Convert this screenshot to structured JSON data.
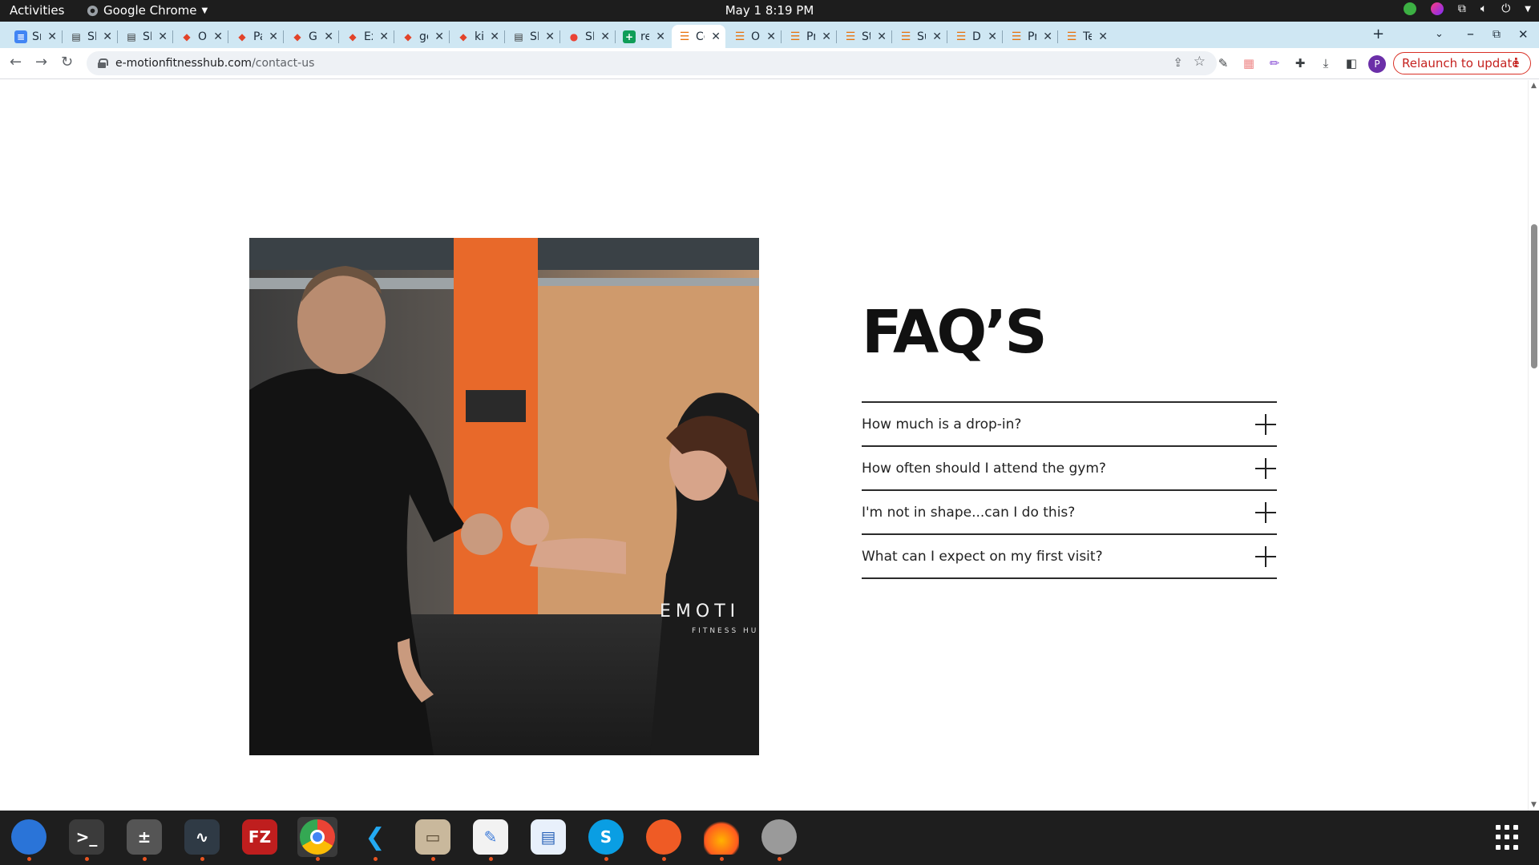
{
  "topbar": {
    "activities": "Activities",
    "app_name": "Google Chrome",
    "clock": "May 1  8:19 PM"
  },
  "tabs": [
    {
      "title": "Sni",
      "icon": "docs-icon",
      "color": "#4285f4"
    },
    {
      "title": "SNI",
      "icon": "snp-icon",
      "color": "#333333"
    },
    {
      "title": "SNI",
      "icon": "snp-icon",
      "color": "#333333"
    },
    {
      "title": "On",
      "icon": "gitlab-icon",
      "color": "#e24329"
    },
    {
      "title": "Pai",
      "icon": "gitlab-icon",
      "color": "#e24329"
    },
    {
      "title": "Gel",
      "icon": "gitlab-icon",
      "color": "#e24329"
    },
    {
      "title": "Exp",
      "icon": "gitlab-icon",
      "color": "#e24329"
    },
    {
      "title": "gel",
      "icon": "gitlab-icon",
      "color": "#e24329"
    },
    {
      "title": "kit",
      "icon": "gitlab-icon",
      "color": "#e24329"
    },
    {
      "title": "SNI",
      "icon": "snp-icon",
      "color": "#333333"
    },
    {
      "title": "SN",
      "icon": "chrome-icon",
      "color": "#34a853"
    },
    {
      "title": "ref",
      "icon": "sheets-icon",
      "color": "#0f9d58"
    },
    {
      "title": "Co",
      "icon": "menu-icon",
      "color": "#e8710a"
    },
    {
      "title": "On",
      "icon": "menu-icon",
      "color": "#e8710a"
    },
    {
      "title": "Pri",
      "icon": "menu-icon",
      "color": "#e8710a"
    },
    {
      "title": "Sta",
      "icon": "menu-icon",
      "color": "#e8710a"
    },
    {
      "title": "Su",
      "icon": "menu-icon",
      "color": "#e8710a"
    },
    {
      "title": "Do",
      "icon": "menu-icon",
      "color": "#e8710a"
    },
    {
      "title": "Pri",
      "icon": "menu-icon",
      "color": "#e8710a"
    },
    {
      "title": "Ter",
      "icon": "menu-icon",
      "color": "#e8710a"
    }
  ],
  "active_tab_index": 12,
  "address_bar": {
    "domain": "e-motionfitnesshub.com",
    "path": "/contact-us"
  },
  "relaunch_label": "Relaunch to update",
  "profile_initial": "P",
  "faq": {
    "title": "FAQ’S",
    "items": [
      {
        "question": "How much is a drop-in?"
      },
      {
        "question": "How often should I attend the gym?"
      },
      {
        "question": "I'm not in shape...can I do this?"
      },
      {
        "question": "What can I expect on my first visit?"
      }
    ]
  },
  "photo": {
    "shirt_text": "EMOTI",
    "shirt_subtext": "FITNESS HU"
  },
  "dock": [
    {
      "name": "thunderbird-icon",
      "label": "",
      "color": "#2a74d8"
    },
    {
      "name": "terminal-icon",
      "label": ">_",
      "color": "#3b3b3b"
    },
    {
      "name": "calculator-icon",
      "label": "±",
      "color": "#555555"
    },
    {
      "name": "system-monitor-icon",
      "label": "∿",
      "color": "#2f3a45"
    },
    {
      "name": "filezilla-icon",
      "label": "FZ",
      "color": "#bf1e1e"
    },
    {
      "name": "chrome-icon",
      "label": "",
      "color": "#ffffff"
    },
    {
      "name": "vscode-icon",
      "label": "",
      "color": "#1e1e1e"
    },
    {
      "name": "files-icon",
      "label": "",
      "color": "#c9b89c"
    },
    {
      "name": "text-editor-icon",
      "label": "",
      "color": "#f2f2f2"
    },
    {
      "name": "libreoffice-writer-icon",
      "label": "",
      "color": "#e8f0fb"
    },
    {
      "name": "skype-icon",
      "label": "S",
      "color": "#0a9ee3"
    },
    {
      "name": "postman-icon",
      "label": "",
      "color": "#ef5b25"
    },
    {
      "name": "app-icon",
      "label": "",
      "color": "#1e1e1e"
    },
    {
      "name": "disk-icon",
      "label": "",
      "color": "#9a9a9a"
    }
  ]
}
